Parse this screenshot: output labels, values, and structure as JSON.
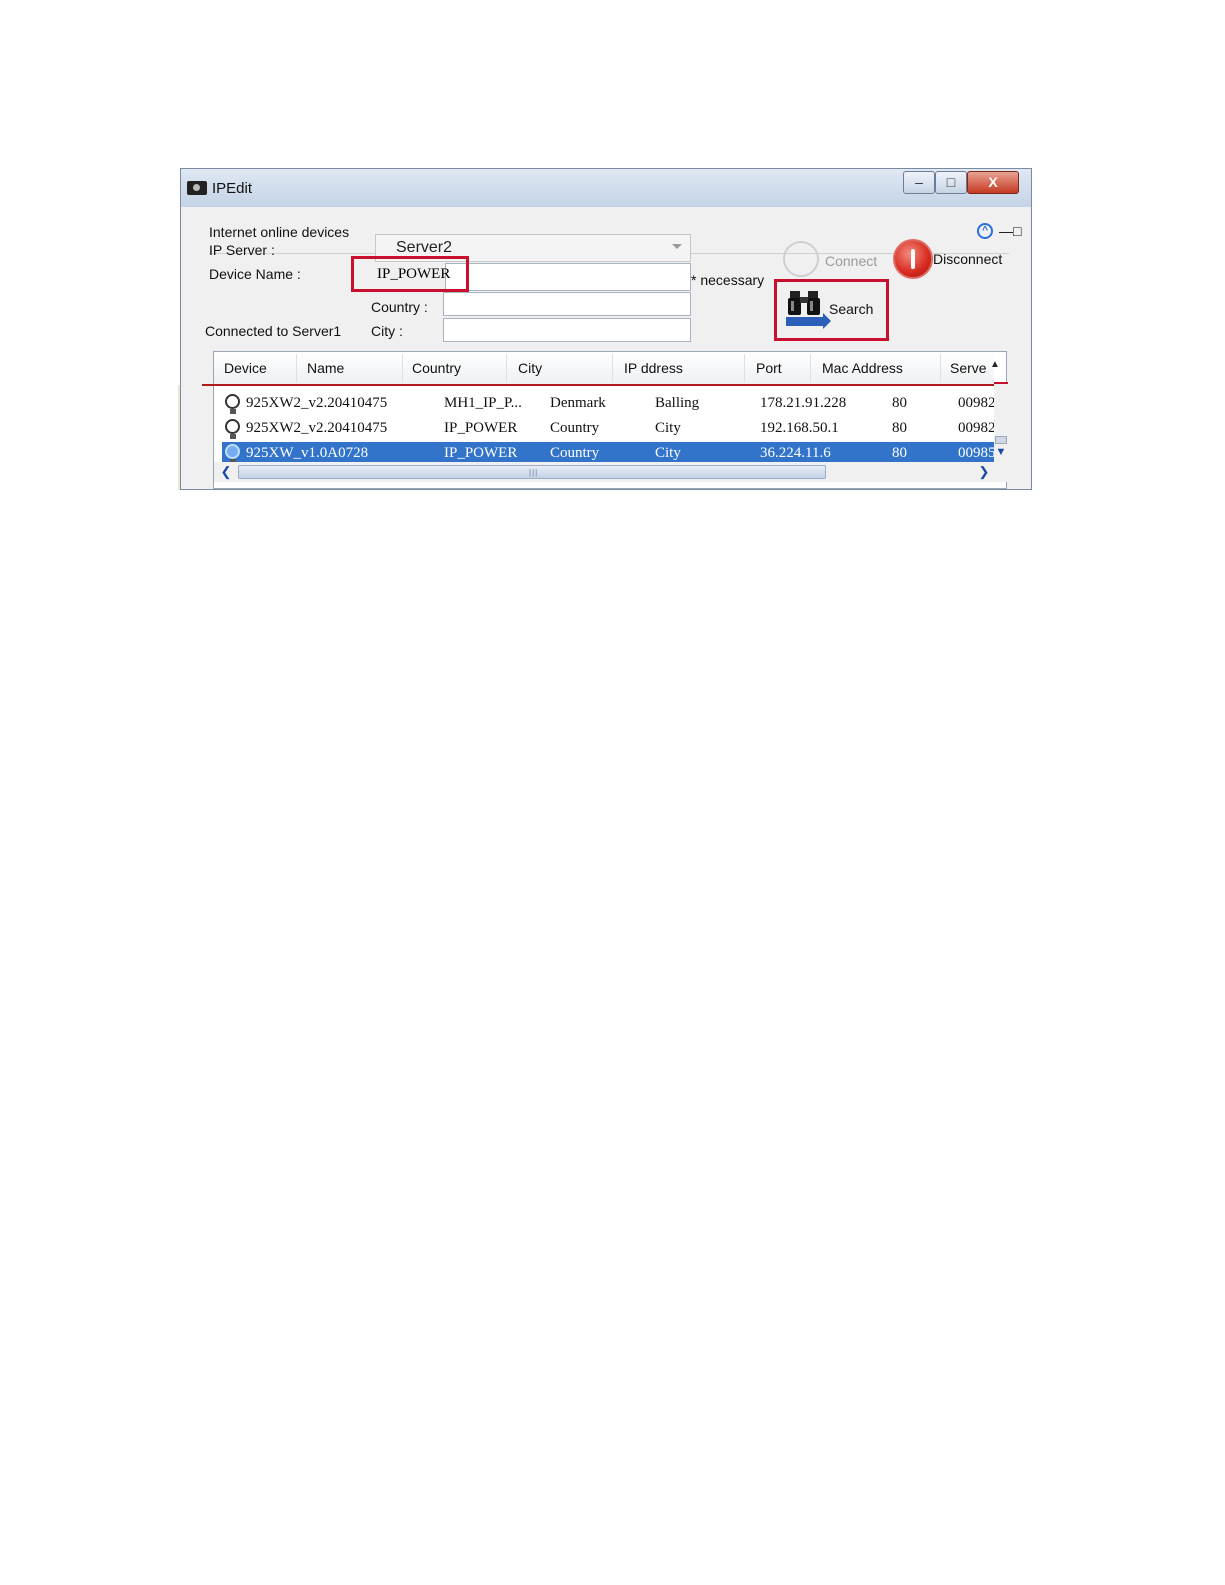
{
  "window": {
    "title": "IPEdit",
    "minimize": "–",
    "maximize": "□",
    "close": "X"
  },
  "form": {
    "group_label": "Internet online devices",
    "ip_server_label": "IP Server :",
    "ip_server_value": "Server2",
    "device_name_label": "Device Name :",
    "device_name_value": "IP_POWER",
    "necessary_note": "* necessary",
    "country_label": "Country :",
    "city_label": "City :",
    "connection_status": "Connected to Server1"
  },
  "actions": {
    "connect": "Connect",
    "disconnect": "Disconnect",
    "search": "Search"
  },
  "table": {
    "columns": [
      "Device",
      "Name",
      "Country",
      "City",
      "IP ddress",
      "Port",
      "Mac Address",
      "Serve"
    ],
    "rows": [
      [
        "925XW2_v2.20410475",
        "MH1_IP_P...",
        "Denmark",
        "Balling",
        "178.21.91.228",
        "80",
        "00982"
      ],
      [
        "925XW2_v2.20410475",
        "IP_POWER",
        "Country",
        "City",
        "192.168.50.1",
        "80",
        "00982"
      ],
      [
        "925XW_v1.0A0728",
        "IP_POWER",
        "Country",
        "City",
        "36.224.11.6",
        "80",
        "00985"
      ]
    ],
    "selected_row": 2
  },
  "colors": {
    "highlight": "#c8102e",
    "selection": "#3274c9"
  }
}
